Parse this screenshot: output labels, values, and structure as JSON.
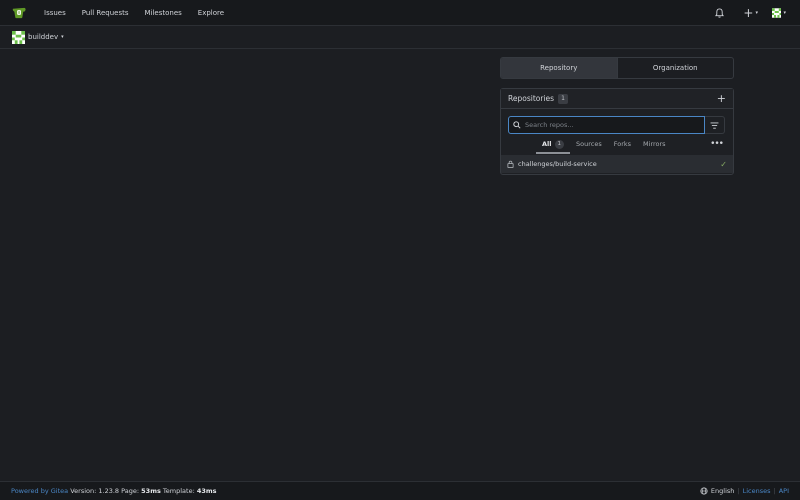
{
  "nav": {
    "items": [
      "Issues",
      "Pull Requests",
      "Milestones",
      "Explore"
    ],
    "create_caret": "▾",
    "avatar_caret": "▾"
  },
  "context": {
    "name": "builddev",
    "caret": "▾"
  },
  "dashboard_tabs": {
    "repository": "Repository",
    "organization": "Organization"
  },
  "repos_panel": {
    "title": "Repositories",
    "count": "1",
    "add": "+",
    "search_placeholder": "Search repos...",
    "filters": {
      "all": "All",
      "all_count": "1",
      "sources": "Sources",
      "forks": "Forks",
      "mirrors": "Mirrors"
    },
    "more": "•••",
    "repos": [
      {
        "name": "challenges/build-service",
        "status": "✓"
      }
    ]
  },
  "footer": {
    "powered": "Powered by Gitea",
    "version_label": "Version:",
    "version": "1.23.8",
    "page_label": "Page:",
    "page_time": "53ms",
    "template_label": "Template:",
    "template_time": "43ms",
    "language": "English",
    "licenses": "Licenses",
    "sep": "|",
    "api": "API"
  },
  "colors": {
    "background": "#1c1e22",
    "navbar": "#17191c",
    "accent": "#4a86c5",
    "logo_green": "#609926",
    "success": "#87ab63"
  },
  "icons": [
    "gitea-logo-icon",
    "bell-icon",
    "plus-icon",
    "avatar-icon",
    "lock-icon",
    "search-icon",
    "filter-icon",
    "kebab-icon",
    "check-icon",
    "globe-icon"
  ]
}
